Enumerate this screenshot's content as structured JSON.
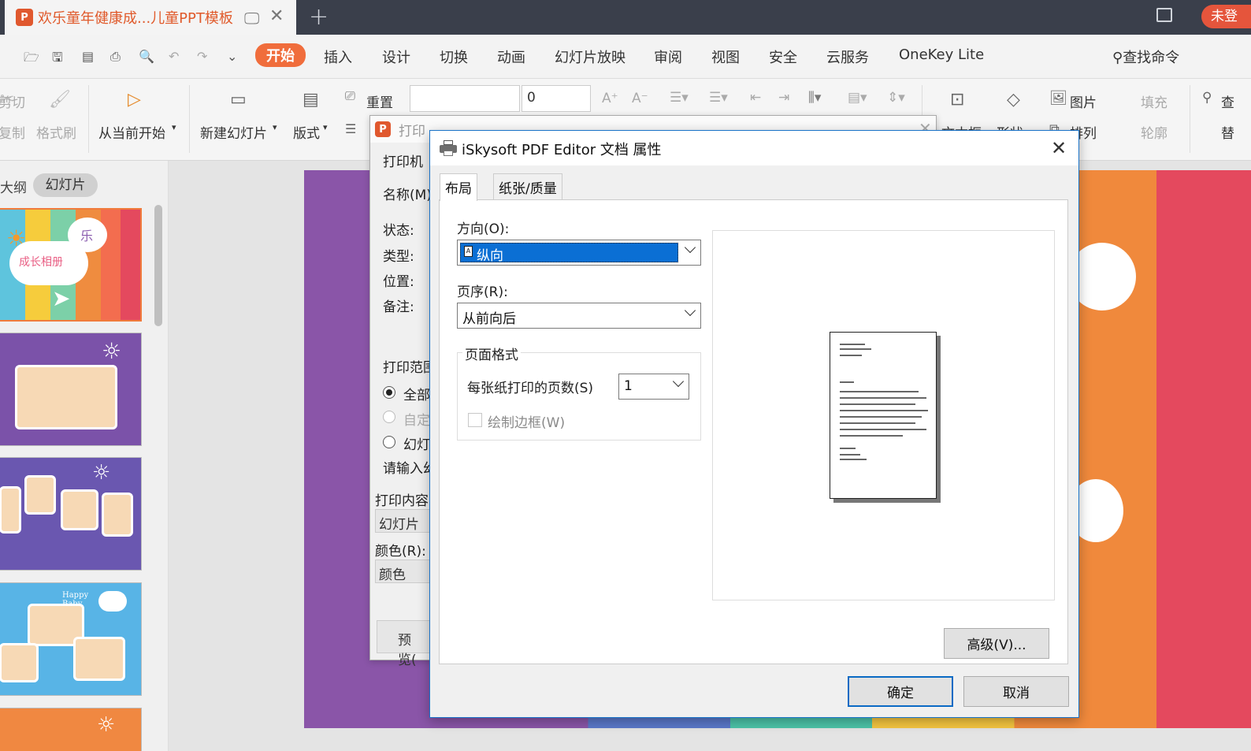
{
  "titlebar": {
    "doc_title": "欢乐童年健康成...儿童PPT模板",
    "logo_text": "P",
    "login_label": "未登"
  },
  "menu": {
    "tabs": [
      "开始",
      "插入",
      "设计",
      "切换",
      "动画",
      "幻灯片放映",
      "审阅",
      "视图",
      "安全",
      "云服务",
      "OneKey Lite"
    ],
    "search": "查找命令"
  },
  "ribbon": {
    "cut": "剪切",
    "copy": "复制",
    "format_painter": "格式刷",
    "from_current": "从当前开始",
    "new_slide": "新建幻灯片",
    "layout": "版式",
    "reset": "重置",
    "font_size": "0",
    "text_box": "文本框",
    "shape": "形状",
    "picture": "图片",
    "arrange": "排列",
    "fill": "填充",
    "outline": "轮廓",
    "find": "查",
    "replace": "替"
  },
  "left_panel": {
    "tab_outline": "大纲",
    "tab_slides": "幻灯片",
    "thumb1_title": "成长相册",
    "thumb1_char": "乐",
    "thumb4_text": "Happy Baby"
  },
  "print_dialog": {
    "title": "打印",
    "printer_section": "打印机",
    "name_label": "名称(M)",
    "status_label": "状态:",
    "type_label": "类型:",
    "location_label": "位置:",
    "comment_label": "备注:",
    "range_section": "打印范围",
    "range_all": "全部",
    "range_custom": "自定",
    "range_slides": "幻灯",
    "input_hint": "请输入幻",
    "content_section": "打印内容",
    "content_value": "幻灯片",
    "color_label": "颜色(R):",
    "color_value": "颜色",
    "preview_button": "预览("
  },
  "properties_dialog": {
    "title": "iSkysoft PDF Editor 文档 属性",
    "tabs": [
      "布局",
      "纸张/质量"
    ],
    "orientation_label": "方向(O):",
    "orientation_value": "纵向",
    "page_order_label": "页序(R):",
    "page_order_value": "从前向后",
    "page_format_legend": "页面格式",
    "pages_per_sheet_label": "每张纸打印的页数(S)",
    "pages_per_sheet_value": "1",
    "draw_borders_label": "绘制边框(W)",
    "draw_borders_checked": false,
    "advanced_button": "高级(V)...",
    "ok_button": "确定",
    "cancel_button": "取消"
  },
  "colors": {
    "accent": "#f06d3c",
    "dialog_border": "#1a73c8",
    "selection": "#0b6fd4"
  }
}
